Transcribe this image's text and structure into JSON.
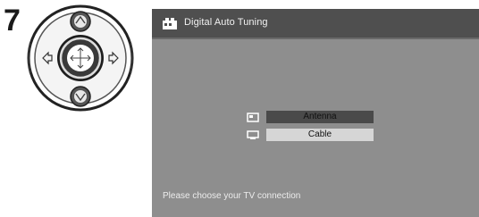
{
  "step_number": "7",
  "screen": {
    "title": "Digital Auto Tuning",
    "options": [
      {
        "label": "Antenna",
        "icon": "antenna-icon",
        "selected": true
      },
      {
        "label": "Cable",
        "icon": "cable-icon",
        "selected": false
      }
    ],
    "hint": "Please choose your TV connection"
  },
  "colors": {
    "screen_bg": "#8e8e8e",
    "titlebar_bg": "#4f4f4f",
    "selected_bg": "#4a4a4a",
    "option_bg": "#d6d6d6"
  },
  "remote": {
    "buttons": [
      "up-arrow-button",
      "down-arrow-button",
      "left-arrow-button",
      "right-arrow-button",
      "enter-button"
    ]
  }
}
